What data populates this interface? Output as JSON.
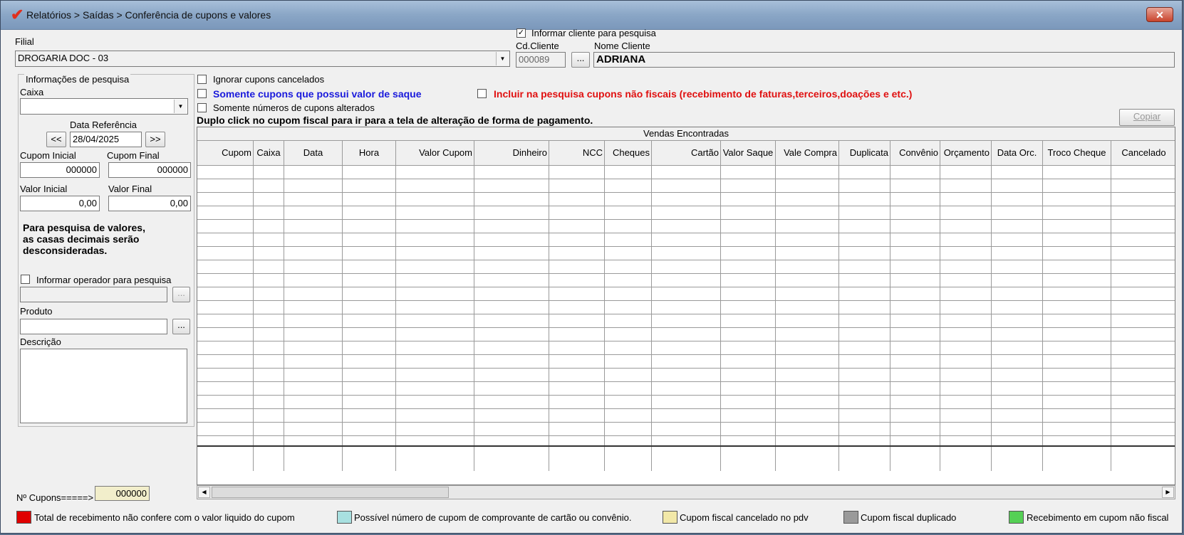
{
  "window": {
    "title": "Relatórios > Saídas > Conferência de cupons e valores",
    "close_label": "✕"
  },
  "filial": {
    "label": "Filial",
    "value": "DROGARIA DOC - 03"
  },
  "cliente": {
    "informar_label": "Informar cliente para pesquisa",
    "informar_checked": true,
    "cd_label": "Cd.Cliente",
    "cd_value": "000089",
    "nome_label": "Nome Cliente",
    "nome_value": "ADRIANA",
    "lookup_label": "..."
  },
  "pesquisa": {
    "group_label": "Informações de pesquisa",
    "caixa_label": "Caixa",
    "caixa_value": "",
    "data_ref_label": "Data Referência",
    "data_ref_value": "28/04/2025",
    "prev_label": "<<",
    "next_label": ">>",
    "cupom_inicial_label": "Cupom Inicial",
    "cupom_inicial_value": "000000",
    "cupom_final_label": "Cupom Final",
    "cupom_final_value": "000000",
    "valor_inicial_label": "Valor Inicial",
    "valor_inicial_value": "0,00",
    "valor_final_label": "Valor Final",
    "valor_final_value": "0,00",
    "note": [
      "Para pesquisa de valores,",
      "as casas decimais serão",
      "desconsideradas."
    ],
    "operador_label": "Informar operador para pesquisa",
    "operador_lookup": "...",
    "produto_label": "Produto",
    "produto_lookup": "...",
    "descricao_label": "Descrição"
  },
  "options": {
    "ignorar_cancelados": "Ignorar cupons cancelados",
    "somente_saque": "Somente cupons que possui valor de saque",
    "incluir_nao_fiscais": "Incluir na pesquisa cupons não fiscais (recebimento de faturas,terceiros,doações  e etc.)",
    "somente_alterados": "Somente números de cupons alterados",
    "duplo_click_hint": "Duplo click no cupom fiscal para ir para a tela de alteração de forma de pagamento.",
    "copiar_label": "Copiar"
  },
  "grid": {
    "title": "Vendas Encontradas",
    "columns": [
      "Cupom",
      "Caixa",
      "Data",
      "Hora",
      "Valor Cupom",
      "Dinheiro",
      "NCC",
      "Cheques",
      "Cartão",
      "Valor Saque",
      "Vale Compra",
      "Duplicata",
      "Convênio",
      "Orçamento",
      "Data Orc.",
      "Troco Cheque",
      "Cancelado"
    ]
  },
  "footer": {
    "n_cupons_label": "Nº Cupons=====>",
    "n_cupons_value": "000000"
  },
  "legend": [
    {
      "color": "#e00000",
      "label": "Total de recebimento não confere com o valor liquido do cupom"
    },
    {
      "color": "#a8e0e0",
      "label": "Possível número de cupom de comprovante de cartão ou convênio."
    },
    {
      "color": "#f2e8a8",
      "label": "Cupom fiscal cancelado no pdv"
    },
    {
      "color": "#9a9a9a",
      "label": "Cupom fiscal duplicado"
    },
    {
      "color": "#55d055",
      "label": "Recebimento em cupom não fiscal"
    }
  ],
  "colors": {
    "blue_option": "#1a1adc",
    "red_option": "#e01010"
  }
}
